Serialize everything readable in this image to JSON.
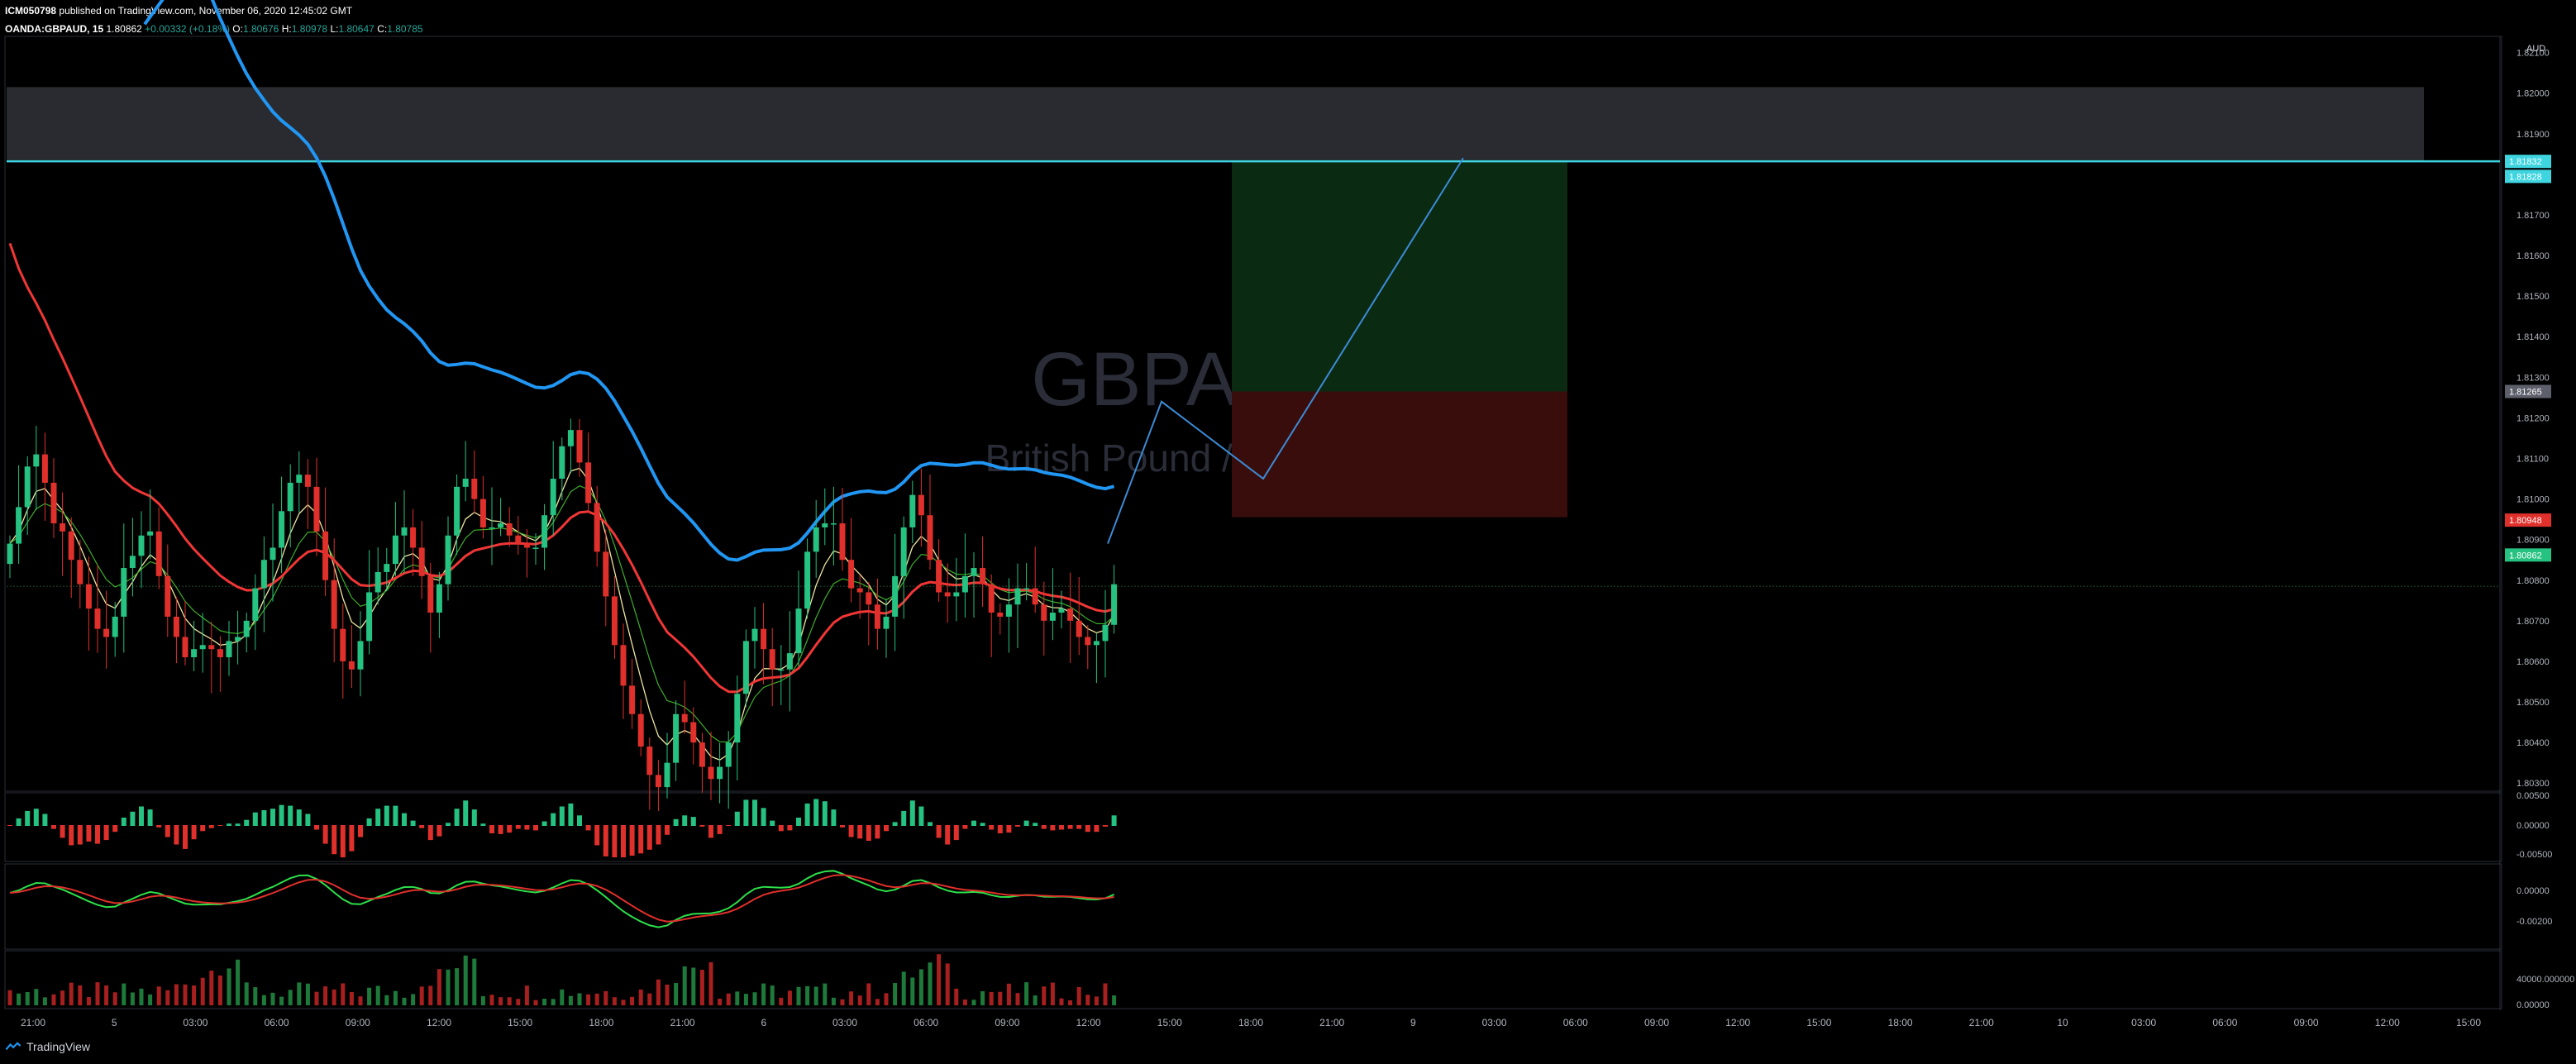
{
  "header": {
    "author": "ICM050798",
    "published": "published on TradingView.com, November 06, 2020 12:45:02 GMT",
    "symbol": "OANDA:GBPAUD, 15",
    "last": "1.80862",
    "change": "+0.00332 (+0.18%)",
    "o_label": "O:",
    "o": "1.80676",
    "h_label": "H:",
    "h": "1.80978",
    "l_label": "L:",
    "l": "1.80647",
    "c_label": "C:",
    "c": "1.80785"
  },
  "watermark": {
    "title": "GBPAUD, 15",
    "subtitle": "British Pound / Australian Dollar"
  },
  "footer": {
    "brand": "TradingView"
  },
  "colors": {
    "up": "#26c281",
    "down": "#e0302b",
    "ema_slow": "#2196f3",
    "ema_mid": "#f23636",
    "level": "#3fd5e0",
    "path": "#3c8bd6"
  },
  "chart_data": {
    "type": "candlestick",
    "currency": "AUD",
    "price_ticks": [
      "1.82100",
      "1.82000",
      "1.81900",
      "1.81800",
      "1.81700",
      "1.81600",
      "1.81500",
      "1.81400",
      "1.81300",
      "1.81200",
      "1.81100",
      "1.81000",
      "1.80900",
      "1.80800",
      "1.80700",
      "1.80600",
      "1.80500",
      "1.80400",
      "1.80300"
    ],
    "ylim": [
      1.8028,
      1.8214
    ],
    "price_labels": [
      {
        "text": "1.81832",
        "value": 1.81832,
        "color": "#3fd5e0"
      },
      {
        "text": "1.81828",
        "value": 1.81795,
        "color": "#3fd5e0"
      },
      {
        "text": "1.81265",
        "value": 1.81265,
        "color": "#5d606b"
      },
      {
        "text": "1.80948",
        "value": 1.80948,
        "color": "#e0302b"
      },
      {
        "text": "1.80862",
        "value": 1.80862,
        "color": "#26c281"
      }
    ],
    "x_ticks": [
      "21:00",
      "5",
      "03:00",
      "06:00",
      "09:00",
      "12:00",
      "15:00",
      "18:00",
      "21:00",
      "6",
      "03:00",
      "06:00",
      "09:00",
      "12:00",
      "15:00",
      "18:00",
      "21:00",
      "9",
      "03:00",
      "06:00",
      "09:00",
      "12:00",
      "15:00",
      "18:00",
      "21:00",
      "10",
      "03:00",
      "06:00",
      "09:00",
      "12:00",
      "15:00"
    ],
    "resistance_level": 1.81832,
    "supply_zone": [
      1.81835,
      1.82015
    ],
    "position": {
      "entry": 1.81265,
      "target": 1.81832,
      "stop": 1.80955
    },
    "projection": [
      1.8089,
      1.8124,
      1.8105,
      1.8184
    ],
    "closes": [
      1.8089,
      1.8098,
      1.8108,
      1.8111,
      1.8104,
      1.8094,
      1.8092,
      1.8085,
      1.8079,
      1.8073,
      1.8068,
      1.8066,
      1.8071,
      1.8083,
      1.8086,
      1.8091,
      1.8092,
      1.8081,
      1.8071,
      1.8066,
      1.8061,
      1.8063,
      1.8064,
      1.8063,
      1.8061,
      1.8065,
      1.8066,
      1.807,
      1.8078,
      1.8085,
      1.8088,
      1.8097,
      1.8104,
      1.8106,
      1.8103,
      1.8092,
      1.808,
      1.8068,
      1.806,
      1.8058,
      1.8065,
      1.8077,
      1.8082,
      1.8084,
      1.8091,
      1.8093,
      1.8088,
      1.8081,
      1.8072,
      1.8079,
      1.8091,
      1.8103,
      1.8105,
      1.81,
      1.8093,
      1.8093,
      1.8094,
      1.8091,
      1.8089,
      1.8088,
      1.8088,
      1.8096,
      1.8105,
      1.8113,
      1.8117,
      1.8109,
      1.8099,
      1.8087,
      1.8076,
      1.8064,
      1.8054,
      1.8047,
      1.8039,
      1.8032,
      1.8029,
      1.8035,
      1.8047,
      1.8045,
      1.804,
      1.8034,
      1.8031,
      1.8034,
      1.804,
      1.8052,
      1.8065,
      1.8068,
      1.8063,
      1.8058,
      1.8058,
      1.8062,
      1.8073,
      1.8087,
      1.8093,
      1.8094,
      1.8094,
      1.8085,
      1.8078,
      1.8077,
      1.8074,
      1.8068,
      1.8071,
      1.8081,
      1.8093,
      1.8101,
      1.8096,
      1.8085,
      1.8077,
      1.8076,
      1.8077,
      1.8081,
      1.8083,
      1.8079,
      1.8072,
      1.8071,
      1.8074,
      1.8078,
      1.8078,
      1.8074,
      1.807,
      1.8072,
      1.8073,
      1.807,
      1.8066,
      1.8064,
      1.8065,
      1.8069,
      1.8079
    ]
  }
}
